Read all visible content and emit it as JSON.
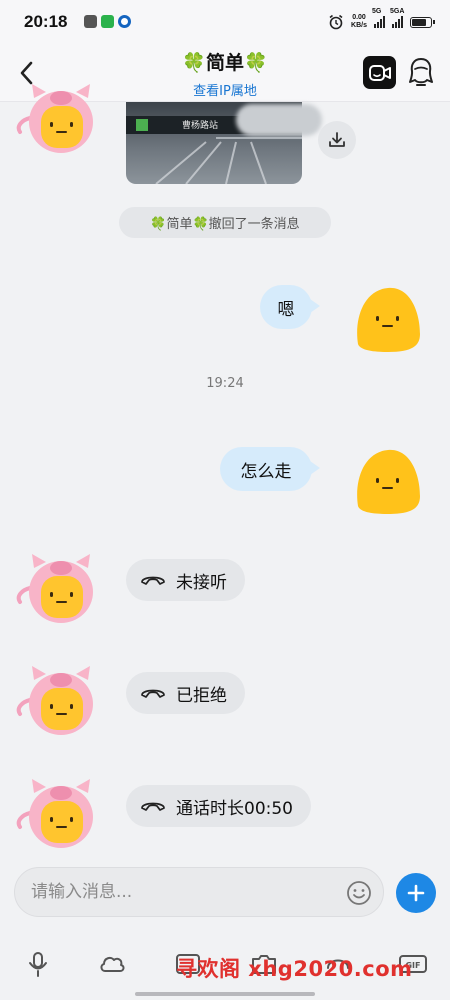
{
  "status_bar": {
    "time": "20:18",
    "net_speed": "0.00",
    "net_unit": "KB/s",
    "signal1_label": "5G",
    "signal2_label": "5GA"
  },
  "header": {
    "title": "🍀简单🍀",
    "subtitle": "查看IP属地"
  },
  "image_message": {
    "sign_text": "曹杨路站"
  },
  "recall_notice": "🍀简单🍀撤回了一条消息",
  "messages": {
    "out1": "嗯",
    "time": "19:24",
    "out2": "怎么走"
  },
  "calls": [
    {
      "label": "未接听"
    },
    {
      "label": "已拒绝"
    },
    {
      "label": "通话时长00:50"
    }
  ],
  "input": {
    "placeholder": "请输入消息..."
  },
  "watermark": "寻欢阁 xhg2020.com",
  "colors": {
    "accent": "#1e88e5",
    "link": "#1976d2",
    "bubble_out": "#d6ebfb",
    "bubble_in": "#e4e6e9"
  },
  "icons": [
    "back-icon",
    "video-call-icon",
    "profile-icon",
    "download-icon",
    "phone-icon",
    "emoji-icon",
    "plus-icon",
    "microphone-icon",
    "cloud-icon",
    "image-icon",
    "camera-icon",
    "gif-icon"
  ]
}
